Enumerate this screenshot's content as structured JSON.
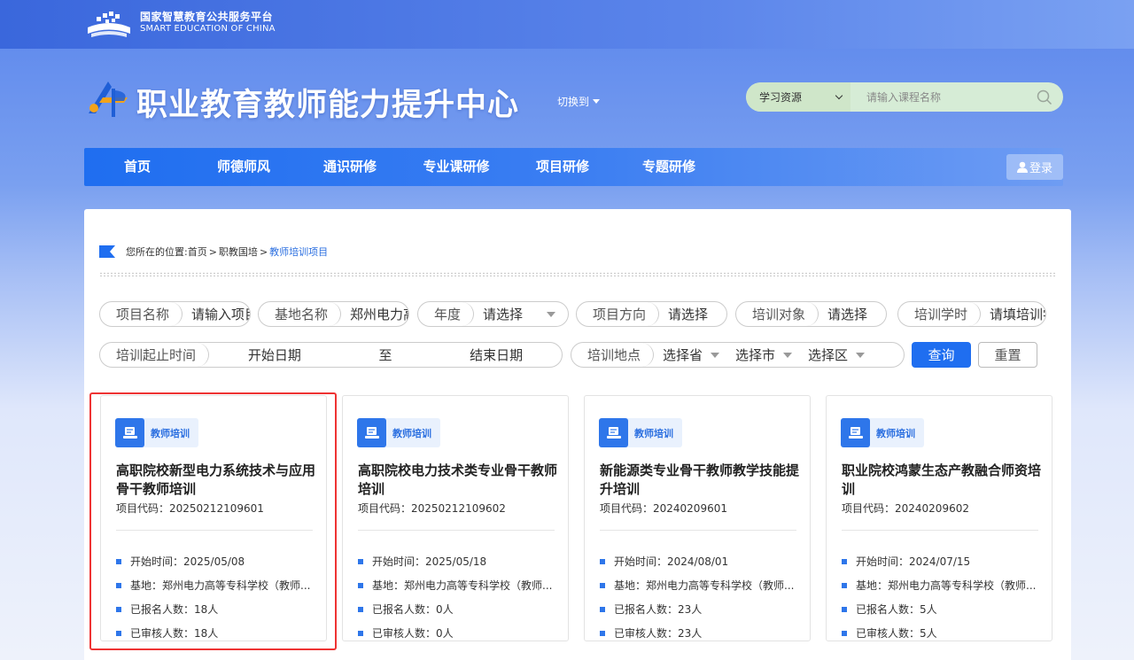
{
  "platform": {
    "name_cn": "国家智慧教育公共服务平台",
    "name_en": "SMART EDUCATION OF CHINA"
  },
  "site": {
    "title": "职业教育教师能力提升中心",
    "switch_label": "切换到"
  },
  "search": {
    "scope": "学习资源",
    "placeholder": "请输入课程名称"
  },
  "nav": {
    "items": [
      "首页",
      "师德师风",
      "通识研修",
      "专业课研修",
      "项目研修",
      "专题研修"
    ],
    "login": "登录"
  },
  "breadcrumb": {
    "prefix": "您所在的位置:",
    "home": "首页",
    "level2": "职教国培",
    "current": "教师培训项目"
  },
  "filters": {
    "project_name": {
      "label": "项目名称",
      "placeholder": "请输入项目名称"
    },
    "base_name": {
      "label": "基地名称",
      "value": "郑州电力高等专科学校"
    },
    "year": {
      "label": "年度",
      "value": "请选择"
    },
    "direction": {
      "label": "项目方向",
      "value": "请选择"
    },
    "target": {
      "label": "培训对象",
      "value": "请选择"
    },
    "hours": {
      "label": "培训学时",
      "placeholder": "请填培训学时"
    },
    "period": {
      "label": "培训起止时间",
      "start": "开始日期",
      "to": "至",
      "end": "结束日期"
    },
    "location": {
      "label": "培训地点",
      "province": "选择省",
      "city": "选择市",
      "district": "选择区"
    },
    "query": "查询",
    "reset": "重置"
  },
  "cards": [
    {
      "tag": "教师培训",
      "title": "高职院校新型电力系统技术与应用骨干教师培训",
      "code": "项目代码：20250212109601",
      "start": "开始时间：2025/05/08",
      "base": "基地：郑州电力高等专科学校（教师...",
      "enrolled": "已报名人数：18人",
      "approved": "已审核人数：18人"
    },
    {
      "tag": "教师培训",
      "title": "高职院校电力技术类专业骨干教师培训",
      "code": "项目代码：20250212109602",
      "start": "开始时间：2025/05/18",
      "base": "基地：郑州电力高等专科学校（教师...",
      "enrolled": "已报名人数：0人",
      "approved": "已审核人数：0人"
    },
    {
      "tag": "教师培训",
      "title": "新能源类专业骨干教师教学技能提升培训",
      "code": "项目代码：20240209601",
      "start": "开始时间：2024/08/01",
      "base": "基地：郑州电力高等专科学校（教师...",
      "enrolled": "已报名人数：23人",
      "approved": "已审核人数：23人"
    },
    {
      "tag": "教师培训",
      "title": "职业院校鸿蒙生态产教融合师资培训",
      "code": "项目代码：20240209602",
      "start": "开始时间：2024/07/15",
      "base": "基地：郑州电力高等专科学校（教师...",
      "enrolled": "已报名人数：5人",
      "approved": "已审核人数：5人"
    }
  ],
  "colors": {
    "primary": "#1f6ef0",
    "highlight": "#e33333",
    "search_bg": "#d6ecd6"
  }
}
